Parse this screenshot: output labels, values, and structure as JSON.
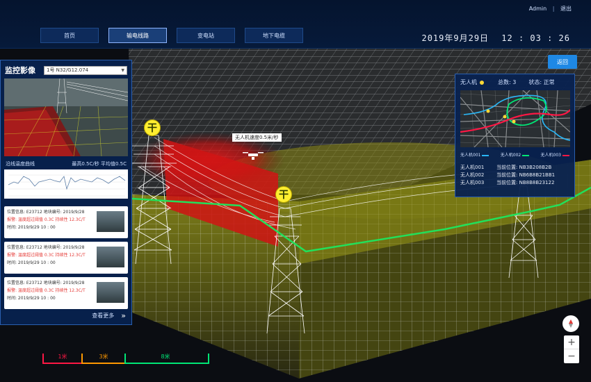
{
  "header": {
    "user": "Admin",
    "separator": "|",
    "logout": "退出",
    "date": "2019年9月29日",
    "time": "12 : 03 : 26",
    "tabs": [
      {
        "label": "首页",
        "active": false
      },
      {
        "label": "输电线路",
        "active": true
      },
      {
        "label": "变电站",
        "active": false
      },
      {
        "label": "地下电缆",
        "active": false
      }
    ]
  },
  "return_button": "返回",
  "left_panel": {
    "title": "监控影像",
    "camera_select": "1号 N32/G12.074",
    "chart_title": "沿线温度曲线",
    "chart_stats": "最高0.5C/秒 平均值0.5C",
    "alerts": [
      {
        "position": "位置信息: E23712  地块编号: 2019/9/28",
        "warning": "报警: 温度超过阈值 0.3C 持续性 12.3C/T",
        "time": "时间: 2019/9/29 10 : 00"
      },
      {
        "position": "位置信息: E23712  地块编号: 2019/9/28",
        "warning": "报警: 温度超过阈值 0.3C 持续性 12.3C/T",
        "time": "时间: 2019/9/29 10 : 00"
      },
      {
        "position": "位置信息: E23712  地块编号: 2019/9/28",
        "warning": "报警: 温度超过阈值 0.3C 持续性 12.3C/T",
        "time": "时间: 2019/9/29 10 : 00"
      }
    ],
    "more": "查看更多",
    "more_icon": "double-chevron-right-icon"
  },
  "right_panel": {
    "title": "无人机",
    "count_label": "总数: 3",
    "status_label": "状态: 正常",
    "legend": [
      {
        "label": "无人机001",
        "color": "#29b6f6"
      },
      {
        "label": "无人机002",
        "color": "#00e676"
      },
      {
        "label": "无人机003",
        "color": "#ff1744"
      }
    ],
    "drones": [
      {
        "name": "无人机001",
        "position": "当前位置: NB3B208B2B"
      },
      {
        "name": "无人机002",
        "position": "当前位置: NB6B8B21BB1"
      },
      {
        "name": "无人机003",
        "position": "当前位置: NB8B8B23122"
      }
    ]
  },
  "scene": {
    "tower_badge_text": "干",
    "drone_label": "无人机速度0.5米/秒",
    "line_color": "#22e05a"
  },
  "level_legend": [
    {
      "label": "1米",
      "color": "#ff1744"
    },
    {
      "label": "3米",
      "color": "#ff9800"
    },
    {
      "label": "8米",
      "color": "#00e676"
    }
  ],
  "controls": {
    "compass_icon": "compass-icon",
    "zoom_in": "+",
    "zoom_out": "−"
  }
}
